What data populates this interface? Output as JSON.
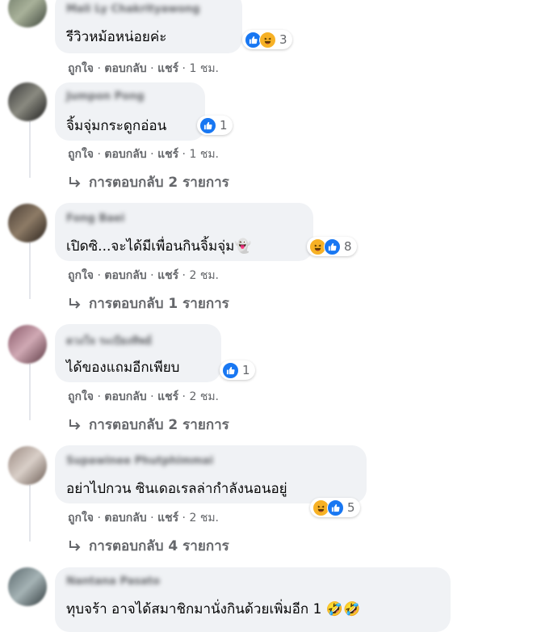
{
  "comments": [
    {
      "author": "Mali Ly Chakrityawong",
      "text": "รีวิวหม้อหน่อยค่ะ",
      "reactions": [
        "like",
        "haha"
      ],
      "reaction_count": "3",
      "like_label": "ถูกใจ",
      "reply_label": "ตอบกลับ",
      "share_label": "แชร์",
      "time": "1 ชม.",
      "replies_label": null
    },
    {
      "author": "Jumpon Pong",
      "text": "จิ้มจุ่มกระดูกอ่อน",
      "reactions": [
        "like"
      ],
      "reaction_count": "1",
      "like_label": "ถูกใจ",
      "reply_label": "ตอบกลับ",
      "share_label": "แชร์",
      "time": "1 ชม.",
      "replies_label": "การตอบกลับ 2 รายการ"
    },
    {
      "author": "Fong Baei",
      "text": "เปิดซิ...จะได้มีเพื่อนกินจิ้มจุ่ม👻",
      "reactions": [
        "haha",
        "like"
      ],
      "reaction_count": "8",
      "like_label": "ถูกใจ",
      "reply_label": "ตอบกลับ",
      "share_label": "แชร์",
      "time": "2 ชม.",
      "replies_label": "การตอบกลับ 1 รายการ"
    },
    {
      "author": "ดวงใจ ระเบียงทิพย์",
      "text": "ได้ของแถมอีกเพียบ",
      "reactions": [
        "like"
      ],
      "reaction_count": "1",
      "like_label": "ถูกใจ",
      "reply_label": "ตอบกลับ",
      "share_label": "แชร์",
      "time": "2 ชม.",
      "replies_label": "การตอบกลับ 2 รายการ"
    },
    {
      "author": "Supawinee Phutphimmai",
      "text": "อย่าไปกวน ซินเดอเรลล่ากำลังนอนอยู่",
      "reactions": [
        "haha",
        "like"
      ],
      "reaction_count": "5",
      "like_label": "ถูกใจ",
      "reply_label": "ตอบกลับ",
      "share_label": "แชร์",
      "time": "2 ชม.",
      "replies_label": "การตอบกลับ 4 รายการ"
    },
    {
      "author": "Nantana Pasato",
      "text": "ทุบจร้า อาจได้สมาชิกมานั่งกินด้วยเพิ่มอีก 1 🤣🤣",
      "reactions": [],
      "reaction_count": "",
      "like_label": "",
      "reply_label": "",
      "share_label": "",
      "time": "",
      "replies_label": null
    }
  ],
  "colors": {
    "bubble": "#f0f2f5",
    "secondary_text": "#65676b",
    "like_blue": "#1877f2",
    "haha_yellow": "#f7b125"
  },
  "icons": {
    "like": "thumbs-up-icon",
    "haha": "laughing-face-icon",
    "replies": "reply-arrow-icon"
  }
}
